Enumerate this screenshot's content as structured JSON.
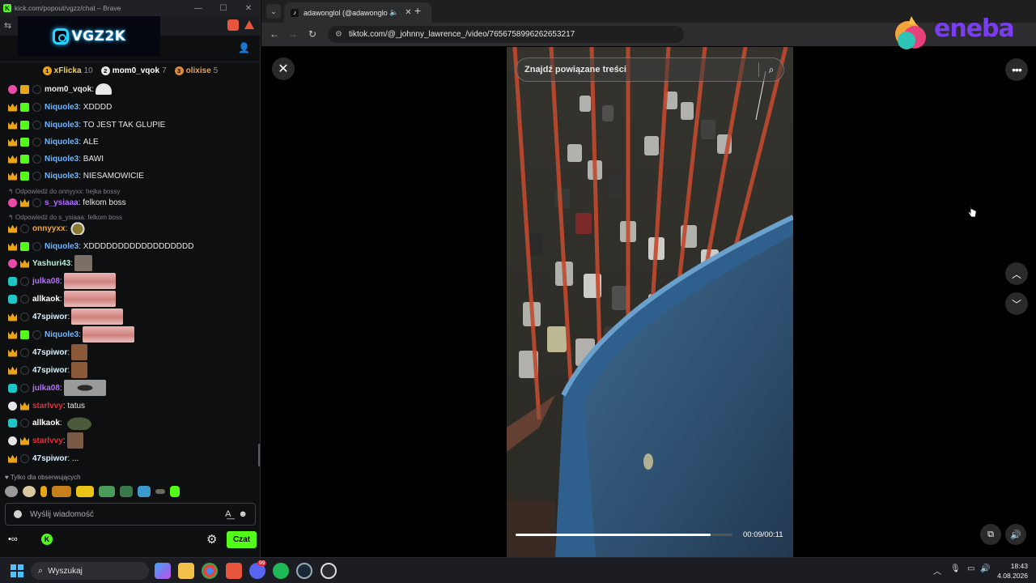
{
  "kick_window": {
    "title": "kick.com/popout/vgzz/chat – Brave",
    "banner": {
      "logo_text": "VGZ2K"
    },
    "leaderboard": [
      {
        "rank": "1",
        "name": "xFlicka",
        "count": "10",
        "color": "#e9a417",
        "name_color": "#f4d16b"
      },
      {
        "rank": "2",
        "name": "mom0_vqok",
        "count": "7",
        "color": "#e6e6e6",
        "name_color": "#ffffff"
      },
      {
        "rank": "3",
        "name": "olixise",
        "count": "5",
        "color": "#d88b3a",
        "name_color": "#e8a25a"
      }
    ],
    "messages": [
      {
        "user": "mom0_vqok",
        "color": "#e6e6e6",
        "text": ""
      },
      {
        "user": "Niquole3",
        "color": "#6fb6ff",
        "text": "XDDDD"
      },
      {
        "user": "Niquole3",
        "color": "#6fb6ff",
        "text": "TO JEST TAK GLUPIE"
      },
      {
        "user": "Niquole3",
        "color": "#6fb6ff",
        "text": "ALE"
      },
      {
        "user": "Niquole3",
        "color": "#6fb6ff",
        "text": "BAWI"
      },
      {
        "user": "Niquole3",
        "color": "#6fb6ff",
        "text": "NIESAMOWICIE"
      },
      {
        "user": "s_ysiaaa",
        "color": "#b46cff",
        "text": "felkom boss"
      },
      {
        "user": "onnyyxx",
        "color": "#f0a640",
        "text": ""
      },
      {
        "user": "Niquole3",
        "color": "#6fb6ff",
        "text": "XDDDDDDDDDDDDDDDDDD"
      },
      {
        "user": "Yashuri43",
        "color": "#b4f0d2",
        "text": ""
      },
      {
        "user": "julka08",
        "color": "#b46cff",
        "text": ""
      },
      {
        "user": "allkaok",
        "color": "#ffffff",
        "text": ""
      },
      {
        "user": "47spiwor",
        "color": "#d8f0ff",
        "text": ""
      },
      {
        "user": "Niquole3",
        "color": "#6fb6ff",
        "text": ""
      },
      {
        "user": "47spiwor",
        "color": "#d8f0ff",
        "text": ""
      },
      {
        "user": "47spiwor",
        "color": "#d8f0ff",
        "text": ""
      },
      {
        "user": "julka08",
        "color": "#b46cff",
        "text": ""
      },
      {
        "user": "starlvvy",
        "color": "#e0303a",
        "text": "tatus"
      },
      {
        "user": "allkaok",
        "color": "#ffffff",
        "text": ""
      },
      {
        "user": "starlvvy",
        "color": "#e0303a",
        "text": ""
      },
      {
        "user": "47spiwor",
        "color": "#d8f0ff",
        "text": "..."
      }
    ],
    "replies": [
      "Odpowiedź do onnyyxx: hejka bossy",
      "Odpowiedź do s_ysiaaa: felkom boss"
    ],
    "followers_only": "Tylko dla obserwujących",
    "input_placeholder": "Wyślij wiadomość",
    "send_button": "Czat"
  },
  "browser": {
    "tab_title": "adawonglol (@adawonglol)",
    "url": "tiktok.com/@_johnny_lawrence_/video/7656758996262653217",
    "video": {
      "search_placeholder": "Znajdź powiązane treści",
      "time": "00:09/00:11",
      "progress_fraction": 0.9
    }
  },
  "ad": {
    "brand": "eneba"
  },
  "taskbar": {
    "search_placeholder": "Wyszukaj",
    "time": "18:43",
    "date": "4.08.2026",
    "discord_badge": "99"
  }
}
